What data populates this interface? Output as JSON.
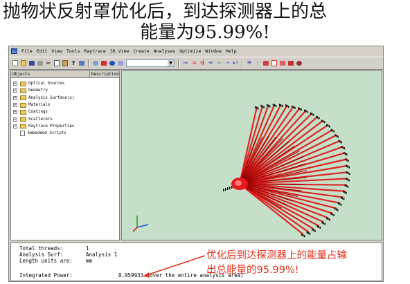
{
  "slide": {
    "title_line1": "抛物状反射罩优化后，到达探测器上的总",
    "title_line2": "能量为95.99%!"
  },
  "menubar": {
    "items": [
      "File",
      "Edit",
      "View",
      "Tools",
      "Raytrace",
      "3D View",
      "Create",
      "Analyses",
      "Optimize",
      "Window",
      "Help"
    ]
  },
  "tree": {
    "col_objects": "Objects",
    "col_description": "Description",
    "items": [
      {
        "label": "Optical Sources",
        "kind": "folder"
      },
      {
        "label": "Geometry",
        "kind": "folder"
      },
      {
        "label": "Analysis Surface(s)",
        "kind": "folder"
      },
      {
        "label": "Materials",
        "kind": "folder"
      },
      {
        "label": "Coatings",
        "kind": "folder"
      },
      {
        "label": "Scatterers",
        "kind": "folder"
      },
      {
        "label": "Raytrace Properties",
        "kind": "folder"
      },
      {
        "label": "Embedded Scripts",
        "kind": "doc"
      }
    ]
  },
  "viewport": {
    "background": "#c5dfc8",
    "ray_color": "#e01010",
    "axis_icon": "xyz-axis-triad-icon"
  },
  "output": {
    "total_threads_label": "Total threads:",
    "total_threads_value": "1",
    "analysis_surf_label": "Analysis Surf:",
    "analysis_surf_value": "Analysis 1",
    "length_units_label": "Length units are:",
    "length_units_value": "mm",
    "integrated_power_label": "Integrated Power:",
    "integrated_power_value": "0.959933",
    "integrated_power_note": "(over the entire analysis area)"
  },
  "annotation": {
    "line1": "优化后到达探测器上的能量占输",
    "line2": "出总能量的95.99%!",
    "color": "#e0301e"
  }
}
